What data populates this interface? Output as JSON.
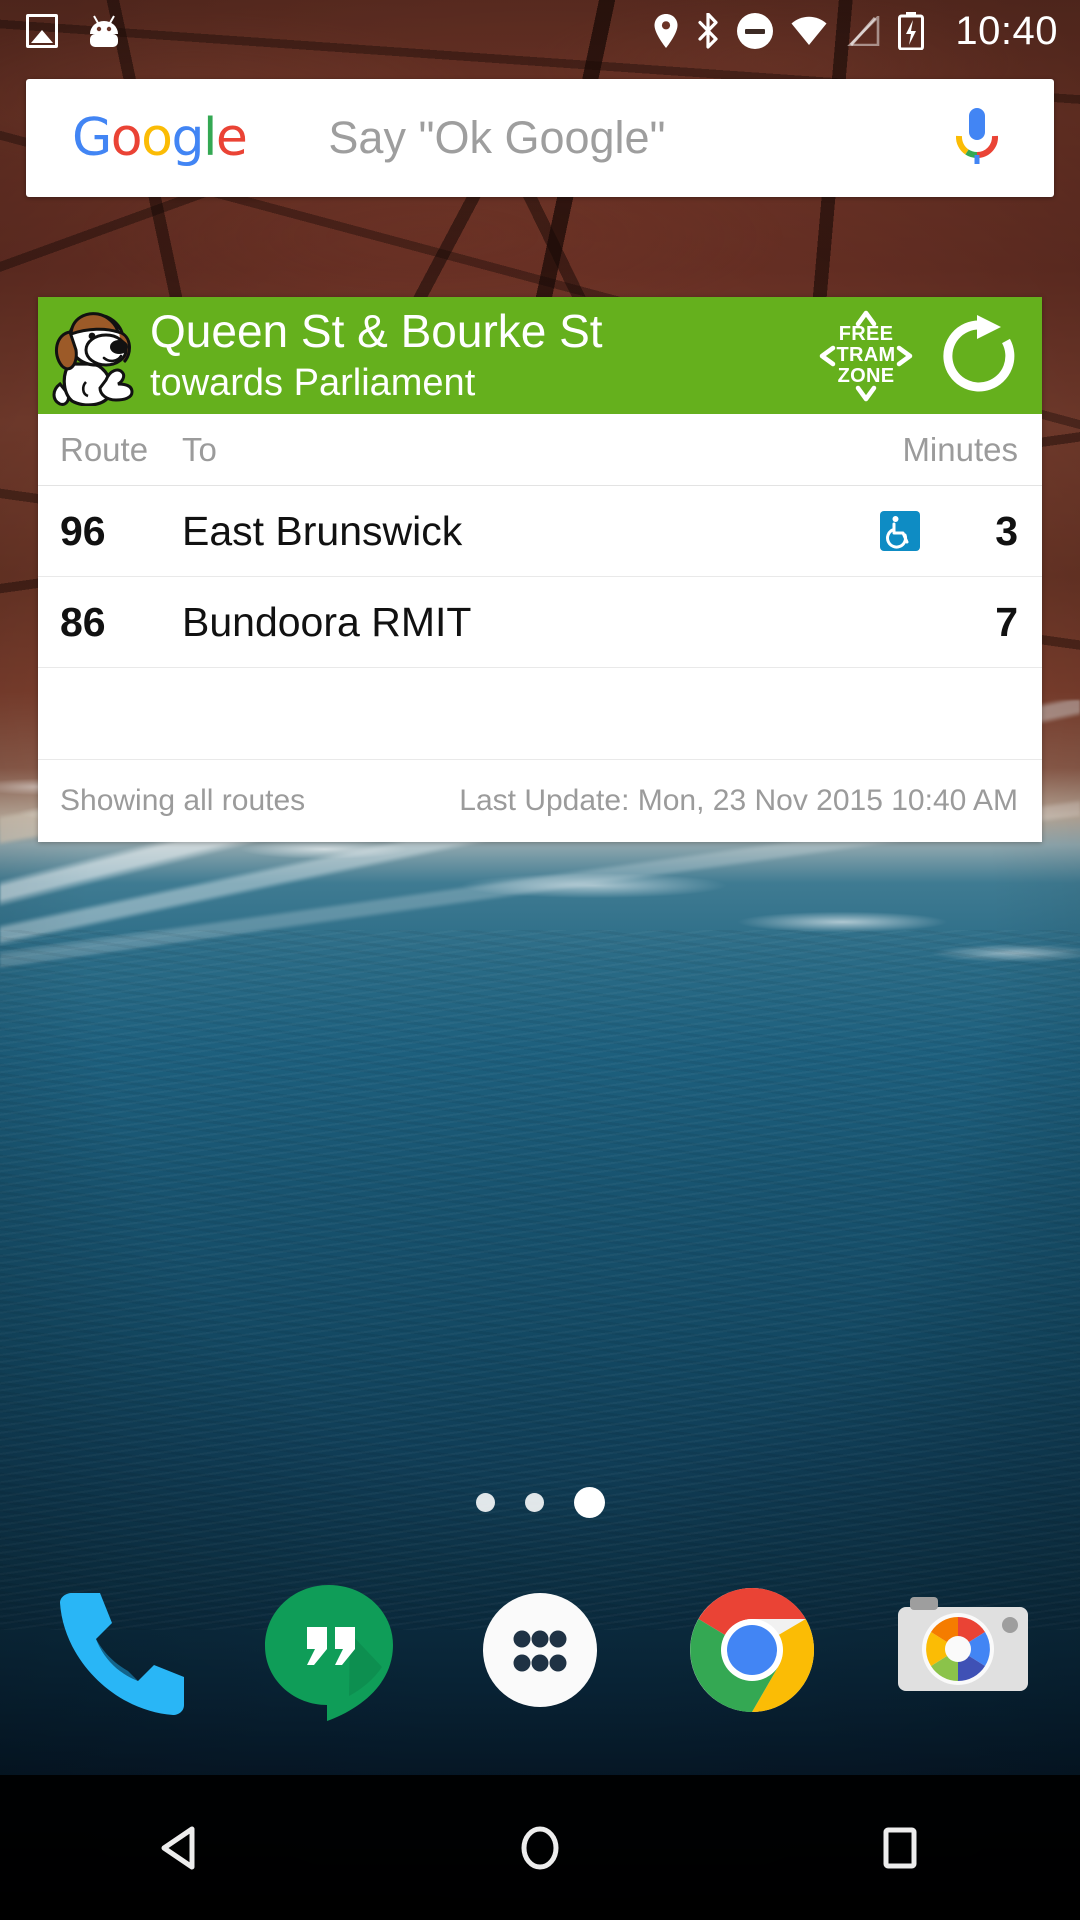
{
  "status_bar": {
    "time": "10:40",
    "icons": [
      {
        "name": "photo-icon",
        "label": "screenshot"
      },
      {
        "name": "android-icon",
        "label": "android-system"
      },
      {
        "name": "location-pin-icon",
        "label": "location"
      },
      {
        "name": "bluetooth-icon",
        "label": "bluetooth"
      },
      {
        "name": "do-not-disturb-icon",
        "label": "do-not-disturb"
      },
      {
        "name": "wifi-icon",
        "label": "wifi"
      },
      {
        "name": "cellular-signal-icon",
        "label": "no-signal"
      },
      {
        "name": "battery-charging-icon",
        "label": "battery-charging"
      }
    ]
  },
  "search": {
    "logo": "Google",
    "logo_letters": [
      "G",
      "o",
      "o",
      "g",
      "l",
      "e"
    ],
    "placeholder": "Say \"Ok Google\"",
    "mic_icon": "microphone-icon",
    "colors": {
      "blue": "#4285F4",
      "red": "#EA4335",
      "yellow": "#FBBC05",
      "green": "#34A853"
    }
  },
  "tram_widget": {
    "header": {
      "stop_name": "Queen St & Bourke St",
      "direction": "towards Parliament",
      "mascot_icon": "dog-mascot-icon",
      "free_tram_zone": {
        "line1": "FREE",
        "line2": "TRAM",
        "line3": "ZONE",
        "icon": "free-tram-zone-badge"
      },
      "refresh_icon": "refresh-icon",
      "background_color": "#65B01D"
    },
    "columns": {
      "route": "Route",
      "to": "To",
      "minutes": "Minutes"
    },
    "departures": [
      {
        "route": "96",
        "destination": "East Brunswick",
        "accessible": true,
        "accessible_icon": "wheelchair-icon",
        "minutes": "3"
      },
      {
        "route": "86",
        "destination": "Bundoora RMIT",
        "accessible": false,
        "accessible_icon": "wheelchair-icon",
        "minutes": "7"
      }
    ],
    "footer": {
      "filter_status": "Showing all routes",
      "last_update": "Last Update: Mon, 23 Nov 2015 10:40 AM"
    },
    "accent_color": "#0E8CC4"
  },
  "home": {
    "page_dots": {
      "count": 3,
      "active_index": 2
    }
  },
  "dock": {
    "items": [
      {
        "name": "dock-phone",
        "label": "Phone",
        "icon": "phone-icon"
      },
      {
        "name": "dock-hangouts",
        "label": "Hangouts",
        "icon": "hangouts-icon"
      },
      {
        "name": "dock-app-drawer",
        "label": "Apps",
        "icon": "app-drawer-icon"
      },
      {
        "name": "dock-chrome",
        "label": "Chrome",
        "icon": "chrome-icon"
      },
      {
        "name": "dock-camera",
        "label": "Camera",
        "icon": "camera-icon"
      }
    ]
  },
  "nav_bar": {
    "buttons": [
      {
        "name": "nav-back",
        "label": "Back",
        "icon": "back-triangle-icon"
      },
      {
        "name": "nav-home",
        "label": "Home",
        "icon": "home-circle-icon"
      },
      {
        "name": "nav-recents",
        "label": "Recents",
        "icon": "recents-square-icon"
      }
    ]
  }
}
